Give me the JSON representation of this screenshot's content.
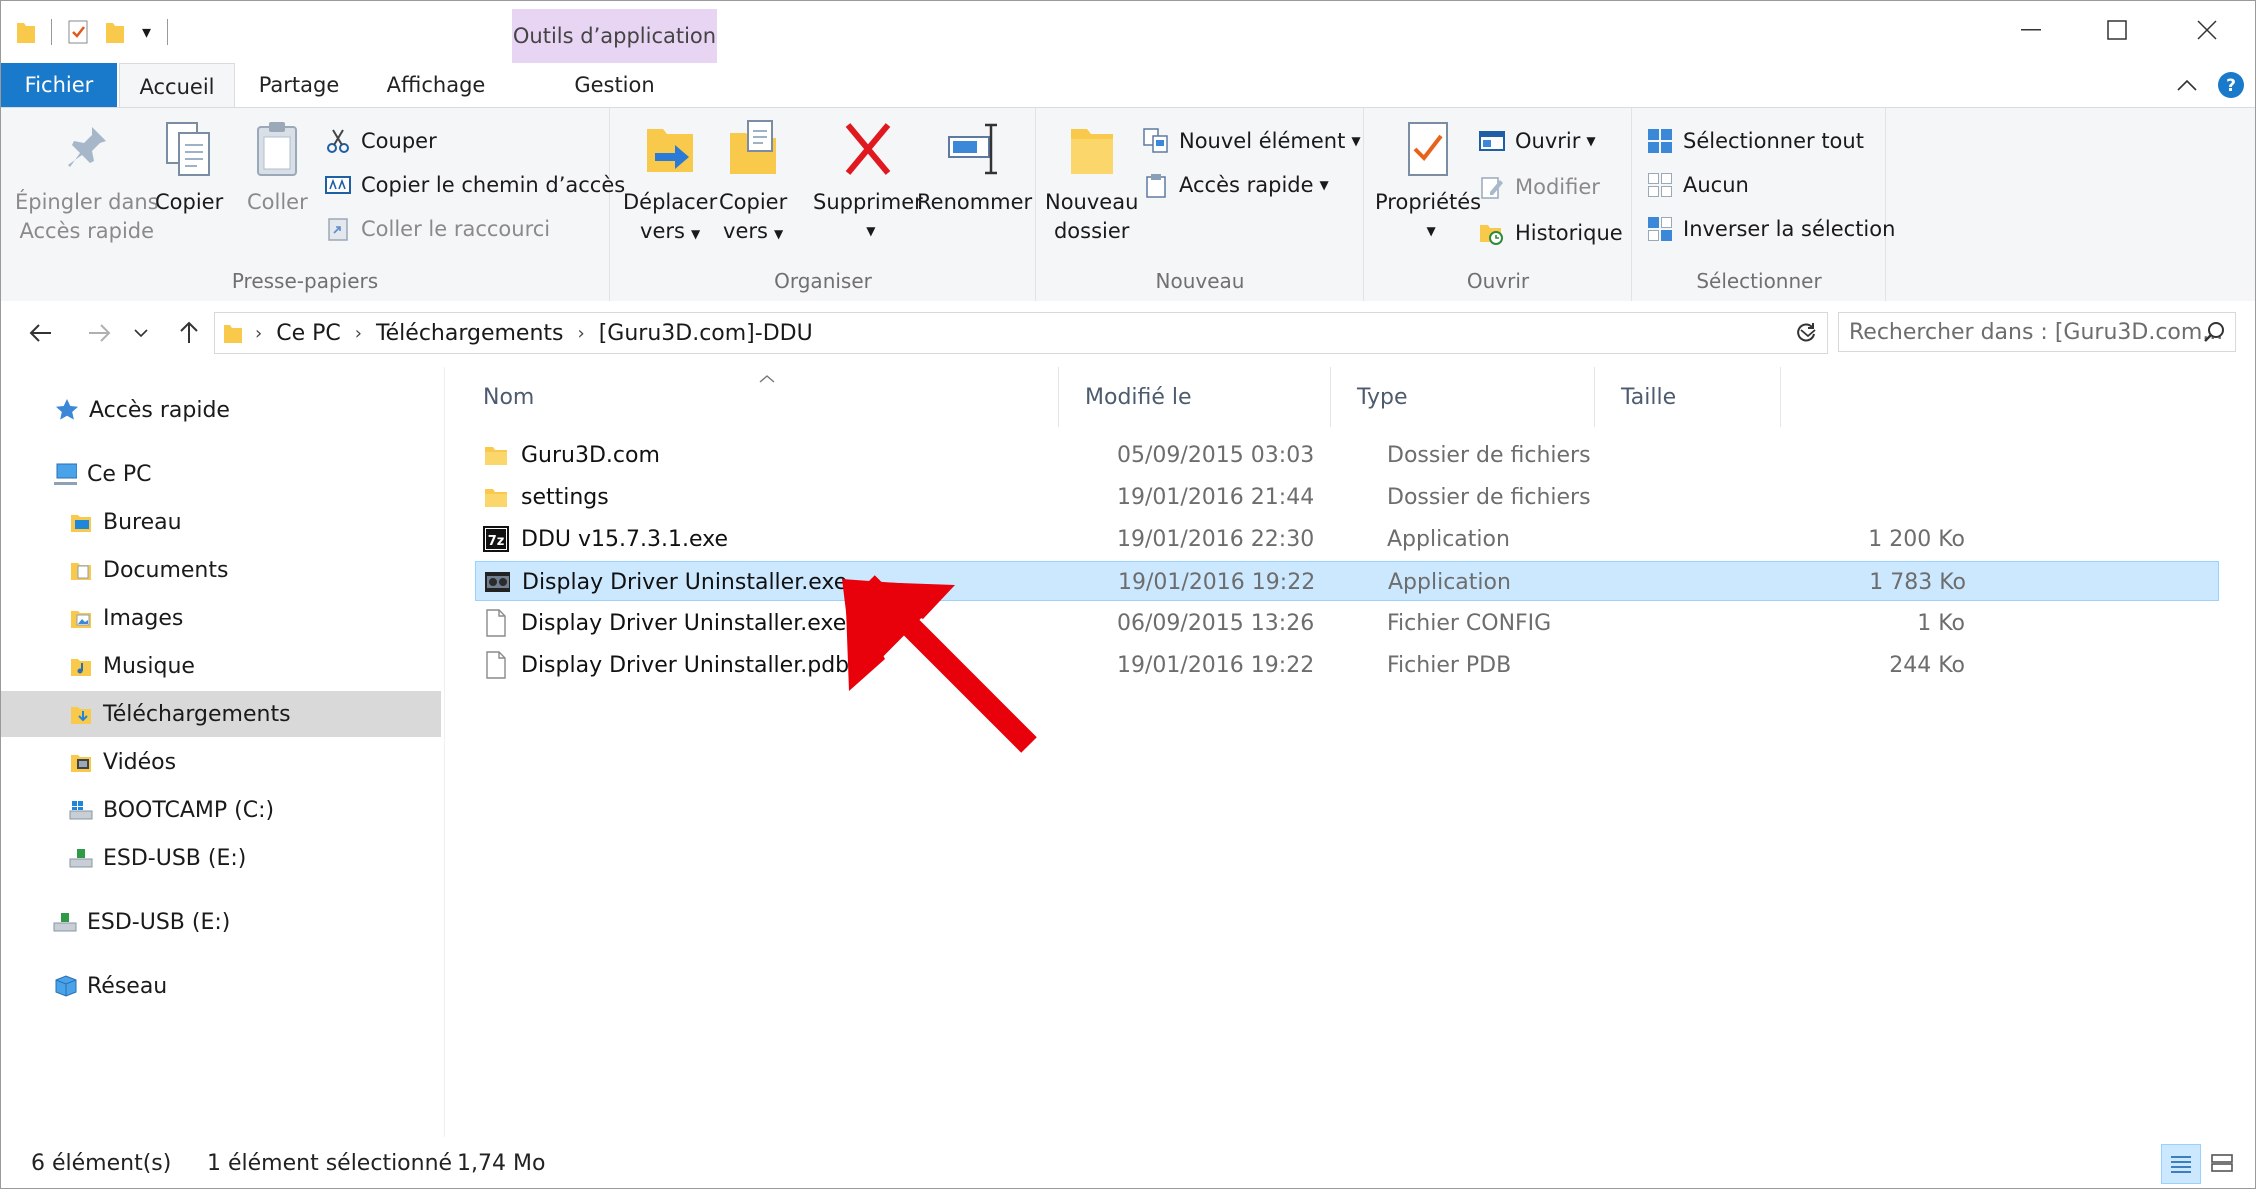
{
  "quick_access_toolbar": {
    "customize_caret": "▾"
  },
  "window_controls": {
    "minimize": "—",
    "maximize": "☐",
    "close": "✕"
  },
  "ribbon_tabs": {
    "file": "Fichier",
    "home": "Accueil",
    "share": "Partage",
    "view": "Affichage",
    "context_group": "Outils d’application",
    "manage": "Gestion"
  },
  "ribbon": {
    "clipboard": {
      "label": "Presse-papiers",
      "pin_line1": "Épingler dans",
      "pin_line2": "Accès rapide",
      "copy": "Copier",
      "paste": "Coller",
      "cut": "Couper",
      "copy_path": "Copier le chemin d’accès",
      "paste_shortcut": "Coller le raccourci"
    },
    "organize": {
      "label": "Organiser",
      "move_line1": "Déplacer",
      "move_line2": "vers",
      "copy_line1": "Copier",
      "copy_line2": "vers",
      "delete": "Supprimer",
      "rename": "Renommer"
    },
    "new": {
      "label": "Nouveau",
      "new_folder_line1": "Nouveau",
      "new_folder_line2": "dossier",
      "new_item": "Nouvel élément",
      "easy_access": "Accès rapide"
    },
    "open": {
      "label": "Ouvrir",
      "properties": "Propriétés",
      "open": "Ouvrir",
      "edit": "Modifier",
      "history": "Historique"
    },
    "select": {
      "label": "Sélectionner",
      "select_all": "Sélectionner tout",
      "select_none": "Aucun",
      "invert": "Inverser la sélection"
    }
  },
  "address_bar": {
    "crumbs": [
      "Ce PC",
      "Téléchargements",
      "[Guru3D.com]-DDU"
    ]
  },
  "search": {
    "placeholder": "Rechercher dans : [Guru3D.com..."
  },
  "nav_pane": {
    "quick_access": "Accès rapide",
    "this_pc": "Ce PC",
    "desktop": "Bureau",
    "documents": "Documents",
    "pictures": "Images",
    "music": "Musique",
    "downloads": "Téléchargements",
    "videos": "Vidéos",
    "bootcamp": "BOOTCAMP (C:)",
    "esd_usb_sub": "ESD-USB (E:)",
    "esd_usb": "ESD-USB (E:)",
    "network": "Réseau"
  },
  "columns": {
    "name": "Nom",
    "modified": "Modifié le",
    "type": "Type",
    "size": "Taille"
  },
  "files": [
    {
      "name": "Guru3D.com",
      "modified": "05/09/2015 03:03",
      "type": "Dossier de fichiers",
      "size": "",
      "icon": "folder-icon"
    },
    {
      "name": "settings",
      "modified": "19/01/2016 21:44",
      "type": "Dossier de fichiers",
      "size": "",
      "icon": "folder-icon"
    },
    {
      "name": "DDU v15.7.3.1.exe",
      "modified": "19/01/2016 22:30",
      "type": "Application",
      "size": "1 200 Ko",
      "icon": "7zip-icon"
    },
    {
      "name": "Display Driver Uninstaller.exe",
      "modified": "19/01/2016 19:22",
      "type": "Application",
      "size": "1 783 Ko",
      "icon": "ddu-app-icon"
    },
    {
      "name": "Display Driver Uninstaller.exe.config",
      "modified": "06/09/2015 13:26",
      "type": "Fichier CONFIG",
      "size": "1 Ko",
      "icon": "blank-file-icon"
    },
    {
      "name": "Display Driver Uninstaller.pdb",
      "modified": "19/01/2016 19:22",
      "type": "Fichier PDB",
      "size": "244 Ko",
      "icon": "blank-file-icon"
    }
  ],
  "status_bar": {
    "count": "6 élément(s)",
    "selection": "1 élément sélectionné",
    "size": "1,74 Mo"
  },
  "colors": {
    "file_tab": "#1979ca",
    "context_tab": "#e8d5f4",
    "selection": "#cce8ff",
    "arrow": "#e8000b"
  }
}
